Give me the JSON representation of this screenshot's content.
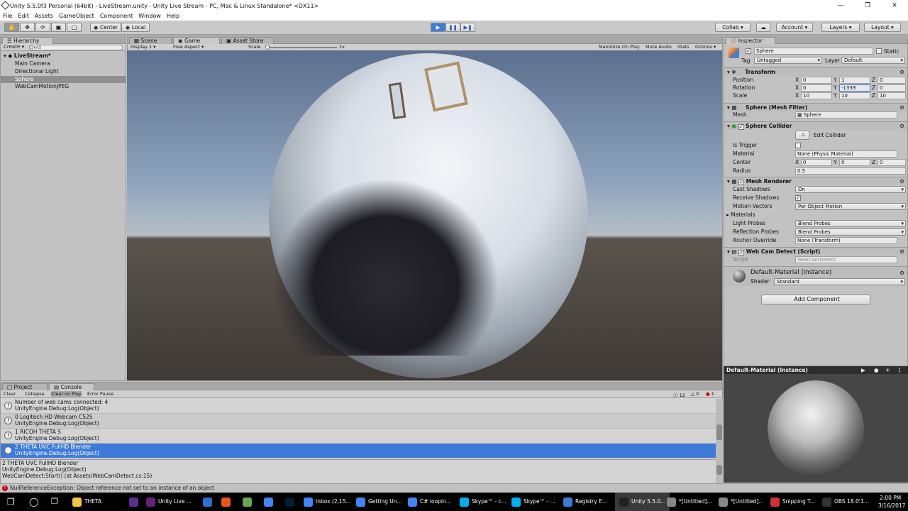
{
  "window": {
    "title": "Unity 5.5.0f3 Personal (64bit) - LiveStream.unity - Unity Live Stream - PC, Mac & Linux Standalone* <DX11>"
  },
  "menu": [
    "File",
    "Edit",
    "Assets",
    "GameObject",
    "Component",
    "Window",
    "Help"
  ],
  "toolbar": {
    "center": "Center",
    "local": "Local",
    "collab": "Collab ▾",
    "account": "Account",
    "layers": "Layers",
    "layout": "Layout"
  },
  "hierarchy": {
    "tab": "Hierarchy",
    "create": "Create ▾",
    "search_placeholder": "Q▾All",
    "scene": "LiveStream*",
    "items": [
      "Main Camera",
      "Directional Light",
      "Sphere",
      "WebCamMotionJPEG"
    ]
  },
  "center_tabs": [
    "Scene",
    "Game",
    "Asset Store"
  ],
  "game_bar": {
    "display": "Display 1",
    "aspect": "Free Aspect",
    "scale_label": "Scale",
    "scale_value": "1x",
    "buttons": [
      "Maximize On Play",
      "Mute Audio",
      "Stats",
      "Gizmos ▾"
    ]
  },
  "inspector": {
    "tab": "Inspector",
    "object_name": "Sphere",
    "static": "Static",
    "tag_label": "Tag",
    "tag": "Untagged",
    "layer_label": "Layer",
    "layer": "Default",
    "transform": {
      "title": "Transform",
      "rows": [
        {
          "label": "Position",
          "x": "0",
          "y": "1",
          "z": "0"
        },
        {
          "label": "Rotation",
          "x": "0",
          "y": "-1339",
          "z": "0"
        },
        {
          "label": "Scale",
          "x": "10",
          "y": "10",
          "z": "10"
        }
      ]
    },
    "mesh_filter": {
      "title": "Sphere (Mesh Filter)",
      "mesh_label": "Mesh",
      "mesh": "Sphere"
    },
    "collider": {
      "title": "Sphere Collider",
      "edit": "Edit Collider",
      "is_trigger": "Is Trigger",
      "material_label": "Material",
      "material": "None (Physic Material)",
      "center_label": "Center",
      "cx": "0",
      "cy": "0",
      "cz": "0",
      "radius_label": "Radius",
      "radius": "0.5"
    },
    "renderer": {
      "title": "Mesh Renderer",
      "cast_label": "Cast Shadows",
      "cast": "On",
      "receive_label": "Receive Shadows",
      "motion_label": "Motion Vectors",
      "motion": "Per Object Motion",
      "materials_label": "Materials",
      "light_label": "Light Probes",
      "light": "Blend Probes",
      "reflection_label": "Reflection Probes",
      "reflection": "Blend Probes",
      "anchor_label": "Anchor Override",
      "anchor": "None (Transform)"
    },
    "script": {
      "title": "Web Cam Detect (Script)",
      "label": "Script",
      "value": "WebCamDetect"
    },
    "material": {
      "title": "Default-Material (Instance)",
      "shader_label": "Shader",
      "shader": "Standard"
    },
    "add_component": "Add Component",
    "preview_title": "Default-Material (Instance)"
  },
  "console": {
    "tabs": [
      "Project",
      "Console"
    ],
    "buttons": [
      "Clear",
      "Collapse",
      "Clear on Play",
      "Error Pause"
    ],
    "counts": {
      "info": "12",
      "warn": "0",
      "error": "1"
    },
    "logs": [
      {
        "l1": "Number of web cams connected: 4",
        "l2": "UnityEngine.Debug:Log(Object)"
      },
      {
        "l1": "0 Logitech HD Webcam C525",
        "l2": "UnityEngine.Debug:Log(Object)"
      },
      {
        "l1": "1 RICOH THETA S",
        "l2": "UnityEngine.Debug:Log(Object)"
      },
      {
        "l1": "2 THETA UVC FullHD Blender",
        "l2": "UnityEngine.Debug:Log(Object)"
      }
    ],
    "detail": [
      "2 THETA UVC FullHD Blender",
      "UnityEngine.Debug:Log(Object)",
      "WebCamDetect:Start() (at Assets/WebCamDetect.cs:15)"
    ],
    "status": "NullReferenceException: Object reference not set to an instance of an object"
  },
  "taskbar": {
    "items": [
      {
        "label": "THETA",
        "color": "#f4c542"
      },
      {
        "label": "",
        "color": "#5c2d91"
      },
      {
        "label": "Unity Live ...",
        "color": "#68217a"
      },
      {
        "label": "",
        "color": "#2c6fd1"
      },
      {
        "label": "",
        "color": "#e95420"
      },
      {
        "label": "",
        "color": "#6aa84f"
      },
      {
        "label": "",
        "color": "#4285f4"
      },
      {
        "label": "",
        "color": "#001e36"
      },
      {
        "label": "Inbox (2,15...",
        "color": "#4285f4"
      },
      {
        "label": "Getting Un...",
        "color": "#4285f4"
      },
      {
        "label": "C# loopin...",
        "color": "#4285f4"
      },
      {
        "label": "Skype™ - c...",
        "color": "#00aff0"
      },
      {
        "label": "Skype™ - ...",
        "color": "#00aff0"
      },
      {
        "label": "Registry E...",
        "color": "#3a7bd5"
      },
      {
        "label": "Unity 5.5.0...",
        "color": "#222"
      },
      {
        "label": "*[Untitled]...",
        "color": "#888"
      },
      {
        "label": "*[Untitled]...",
        "color": "#888"
      },
      {
        "label": "Snipping T...",
        "color": "#c33"
      },
      {
        "label": "OBS 18.0.1...",
        "color": "#333"
      }
    ],
    "time": "2:00 PM",
    "date": "3/16/2017"
  }
}
